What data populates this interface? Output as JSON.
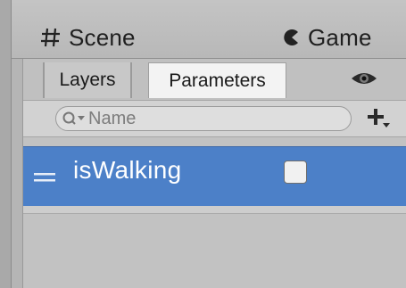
{
  "window_tabs": [
    {
      "label": "Scene",
      "icon": "grid-icon"
    },
    {
      "label": "Game",
      "icon": "pacman-icon"
    }
  ],
  "panel": {
    "tabs": [
      {
        "label": "Layers",
        "selected": false
      },
      {
        "label": "Parameters",
        "selected": true
      }
    ],
    "visibility_icon": "eye-icon",
    "search": {
      "placeholder": "Name",
      "value": ""
    },
    "add_button_icon": "plus-dropdown-icon",
    "parameters": [
      {
        "name": "isWalking",
        "type": "bool",
        "checked": false,
        "selected": true
      }
    ]
  },
  "colors": {
    "selection": "#4c80c8",
    "panel_bg": "#c2c2c2",
    "active_tab_bg": "#f3f3f3"
  }
}
